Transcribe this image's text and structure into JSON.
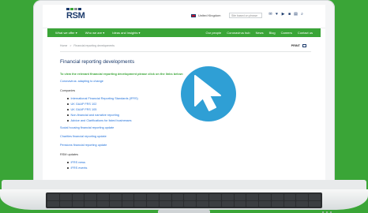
{
  "header": {
    "logo_text": "RSM",
    "region": "United Kingdom",
    "search_placeholder": "Site based on phrase",
    "logo_colors": [
      "#1b3a6b",
      "#3aa537",
      "#8a8f93"
    ],
    "social_icons": [
      "mail-icon",
      "twitter-icon",
      "youtube-icon",
      "linkedin-icon",
      "print-icon",
      "search-icon"
    ]
  },
  "nav": {
    "left": [
      "What we offer  ▾",
      "Who we are  ▾",
      "Ideas and insights  ▾"
    ],
    "right": [
      "Our people",
      "Coronavirus hub",
      "News",
      "Blog",
      "Careers",
      "Contact us"
    ]
  },
  "content": {
    "breadcrumb": [
      "Home",
      ">",
      "Financial reporting developments"
    ],
    "print_label": "PRINT",
    "title": "Financial reporting developments",
    "intro": "To view the relevant financial reporting development please click on the links below:",
    "covid_link": "Coronavirus: adapting to change",
    "companies_heading": "Companies",
    "company_links": [
      "International Financial Reporting Standards (IFRS)",
      "UK GAAP FRS 102",
      "UK GAAP FRS 105",
      "Non-financial and narrative reporting",
      "Advice and Clarifications for listed businesses"
    ],
    "social_housing_link": "Social housing financial reporting update",
    "charities_link": "Charities financial reporting update",
    "pensions_link": "Pensions financial reporting update",
    "rsm_updates_heading": "RSM updates",
    "rsm_update_links": [
      "IFRS news",
      "IFRS events"
    ]
  },
  "colors": {
    "brand_green": "#3aa537",
    "brand_navy": "#1b3a6b",
    "cursor_blue": "#2f9fd5",
    "link_blue": "#1e6fd9"
  }
}
